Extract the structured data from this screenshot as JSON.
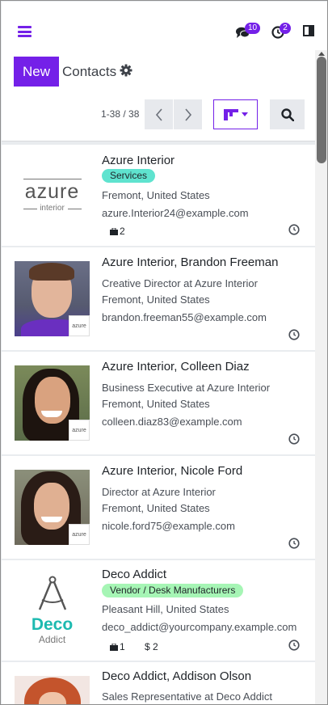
{
  "navbar": {
    "messages_count": "10",
    "activities_count": "2"
  },
  "control": {
    "new_label": "New",
    "breadcrumb": "Contacts",
    "pager_value": "1-38 / 38"
  },
  "colors": {
    "accent": "#7420e8",
    "tag_services": "#5fe3cf",
    "tag_vendor": "#a6f5b5"
  },
  "cards": [
    {
      "title": "Azure Interior",
      "tag": "Services",
      "lines": [
        "Fremont, United States",
        "azure.Interior24@example.com"
      ],
      "stats": [
        {
          "icon": "briefcase-icon",
          "value": "2"
        }
      ],
      "logo_text": "azure",
      "logo_subtext": "interior"
    },
    {
      "title": "Azure Interior, Brandon Freeman",
      "lines": [
        "Creative Director at Azure Interior",
        "Fremont, United States",
        "brandon.freeman55@example.com"
      ]
    },
    {
      "title": "Azure Interior, Colleen Diaz",
      "lines": [
        "Business Executive at Azure Interior",
        "Fremont, United States",
        "colleen.diaz83@example.com"
      ]
    },
    {
      "title": "Azure Interior, Nicole Ford",
      "lines": [
        "Director at Azure Interior",
        "Fremont, United States",
        "nicole.ford75@example.com"
      ]
    },
    {
      "title": "Deco Addict",
      "tag": "Vendor / Desk Manufacturers",
      "lines": [
        "Pleasant Hill, United States",
        "deco_addict@yourcompany.example.com"
      ],
      "stats": [
        {
          "icon": "briefcase-icon",
          "value": "1"
        },
        {
          "icon": "dollar-icon",
          "value": "$ 2"
        }
      ],
      "logo_text": "Deco",
      "logo_subtext": "Addict"
    },
    {
      "title": "Deco Addict, Addison Olson",
      "lines": [
        "Sales Representative at Deco Addict"
      ]
    }
  ]
}
